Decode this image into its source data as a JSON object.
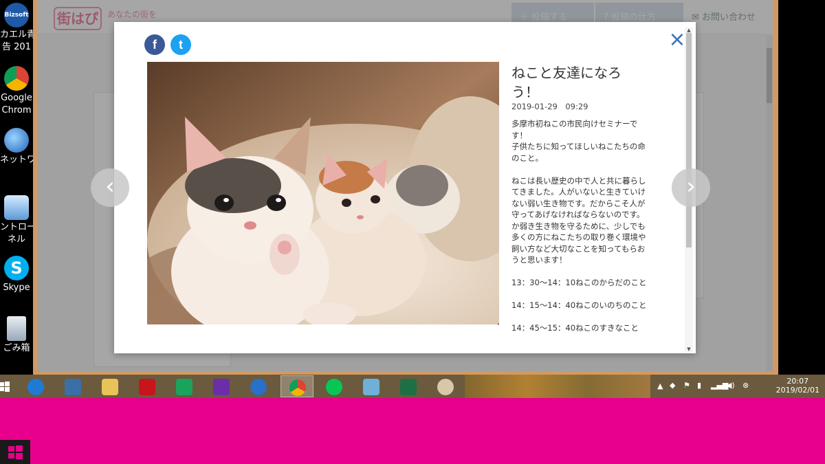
{
  "desktop": {
    "icons": [
      {
        "label": "カエル青",
        "label2": "告 201",
        "color": "#1e5aa8",
        "badge": "Bizsoft"
      },
      {
        "label": "Google",
        "label2": "Chrom",
        "color": "#ffffff"
      },
      {
        "label": "ネットワー",
        "label2": "",
        "color": "#3a7fd0"
      },
      {
        "label": "ントロール",
        "label2": "ネル",
        "color": "#4a90d0"
      },
      {
        "label": "Skype",
        "label2": "",
        "color": "#00aff0"
      },
      {
        "label": "ごみ箱",
        "label2": "",
        "color": "#9aa8b8"
      }
    ]
  },
  "site": {
    "logo": "街はぴ",
    "tagline": "あなたの街を",
    "nav_post": "投稿する",
    "nav_howto": "投稿の仕方",
    "nav_contact": "お問い合わせ"
  },
  "modal": {
    "share_facebook": "f",
    "share_twitter": "t",
    "close_symbol": "×",
    "title": "ねこと友達になろう！",
    "date": "2019-01-29　09:29",
    "body": [
      "多摩市初ねこの市民向けセミナーです！\n子供たちに知ってほしいねこたちの命のこと。",
      "ねこは長い歴史の中で人と共に暮らしてきました。人がいないと生きていけない弱い生き物です。だからこそ人が守ってあげなければならないのです。か弱き生き物を守るために、少しでも多くの方にねこたちの取り巻く環境や飼い方など大切なことを知ってもらおうと思います！",
      "13：30～14：10ねこのからだのこと",
      "14：15～14：40ねこのいのちのこと",
      "14：45～15：40ねこのすきなこと"
    ],
    "prev_symbol": "‹",
    "next_symbol": "›"
  },
  "taskbar": {
    "items": [
      "start",
      "ie",
      "lenovo",
      "explorer",
      "acrobat",
      "store",
      "trophy",
      "mail",
      "chrome",
      "line",
      "app",
      "excel",
      "paint"
    ],
    "clock_time": "20:07",
    "clock_date": "2019/02/01"
  }
}
